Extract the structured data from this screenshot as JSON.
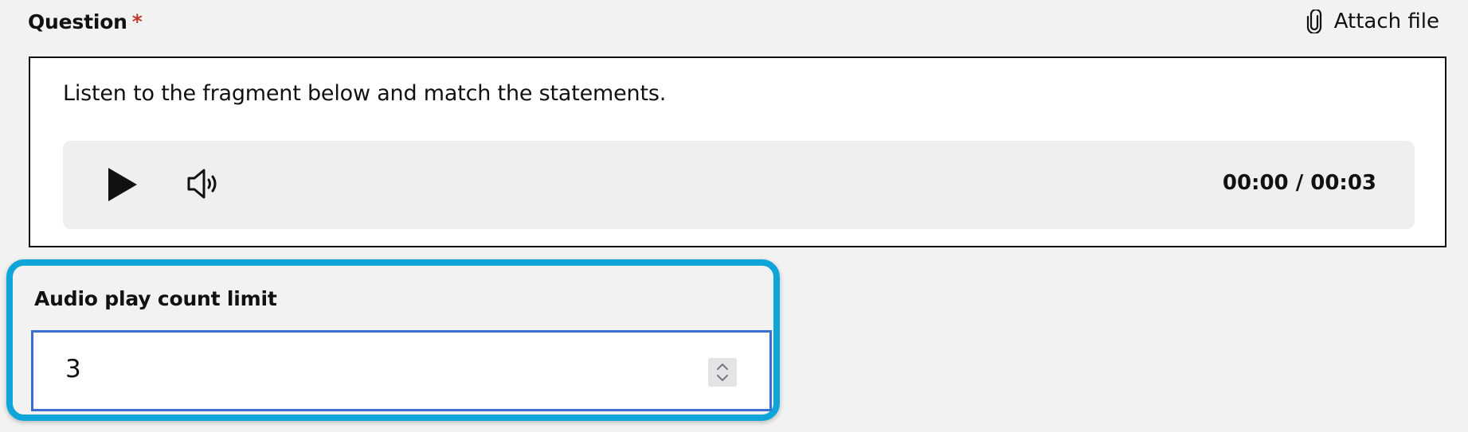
{
  "question": {
    "label": "Question",
    "required_marker": "*",
    "attach_file_label": "Attach file",
    "text": "Listen to the fragment below and match the statements."
  },
  "audio_player": {
    "time": "00:00 / 00:03",
    "play_icon": "play-icon",
    "volume_icon": "volume-icon"
  },
  "audio_limit": {
    "label": "Audio play count limit",
    "value": "3"
  },
  "colors": {
    "highlight_border": "#0ea5d9",
    "input_focus_border": "#3b6fd4",
    "required_star": "#c0392b"
  }
}
